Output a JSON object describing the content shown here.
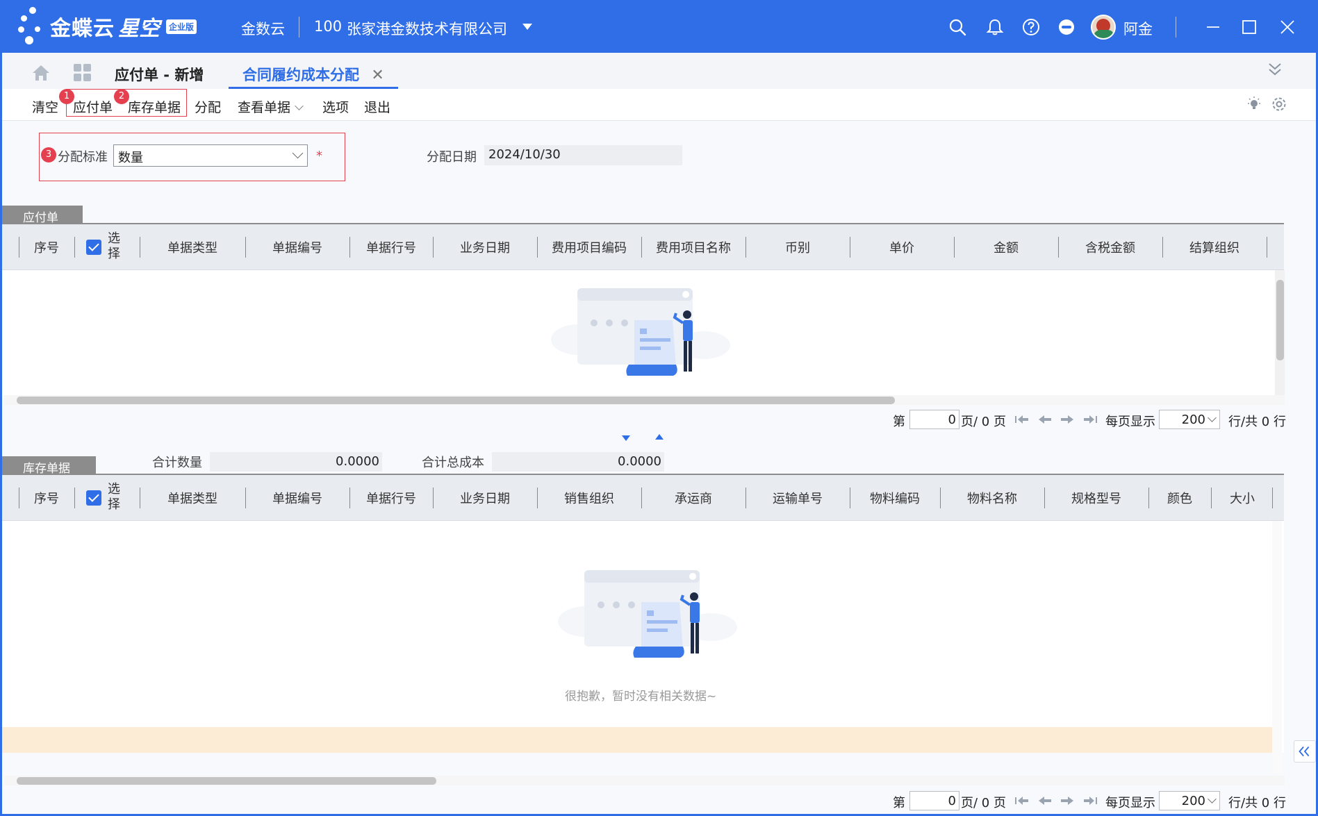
{
  "titlebar": {
    "brand_name": "金蝶云",
    "brand_product": "星空",
    "brand_edition": "企业版",
    "cloud_label": "金数云",
    "org_code": "100",
    "org_name": "张家港金数技术有限公司",
    "user_name": "阿金",
    "colors": {
      "brand": "#2f6ee6"
    }
  },
  "tabs": {
    "current_doc": "应付单 - 新增",
    "active_tab": "合同履约成本分配",
    "close_glyph": "✕"
  },
  "toolbar": {
    "clear": "清空",
    "payable": "应付单",
    "inventory": "库存单据",
    "allocate": "分配",
    "view_docs": "查看单据",
    "options": "选项",
    "exit": "退出",
    "badge1": "1",
    "badge2": "2",
    "badge3": "3"
  },
  "form": {
    "alloc_standard_label": "分配标准",
    "alloc_standard_value": "数量",
    "required_mark": "*",
    "alloc_date_label": "分配日期",
    "alloc_date_value": "2024/10/30"
  },
  "payable_grid": {
    "section_title": "应付单",
    "select_label": "选择",
    "columns": [
      "序号",
      "单据类型",
      "单据编号",
      "单据行号",
      "业务日期",
      "费用项目编码",
      "费用项目名称",
      "币别",
      "单价",
      "金额",
      "含税金额",
      "结算组织"
    ]
  },
  "inventory_grid": {
    "section_title": "库存单据",
    "total_qty_label": "合计数量",
    "total_qty_value": "0.0000",
    "total_cost_label": "合计总成本",
    "total_cost_value": "0.0000",
    "select_label": "选择",
    "columns": [
      "序号",
      "单据类型",
      "单据编号",
      "单据行号",
      "业务日期",
      "销售组织",
      "承运商",
      "运输单号",
      "物料编码",
      "物料名称",
      "规格型号",
      "颜色",
      "大小"
    ],
    "empty_text": "很抱歉，暂时没有相关数据~"
  },
  "pager": {
    "page_prefix": "第",
    "page_value": "0",
    "page_suffix": "页/ 0 页",
    "per_page_label": "每页显示",
    "per_page_value": "200",
    "total_text": "行/共 0 行"
  }
}
